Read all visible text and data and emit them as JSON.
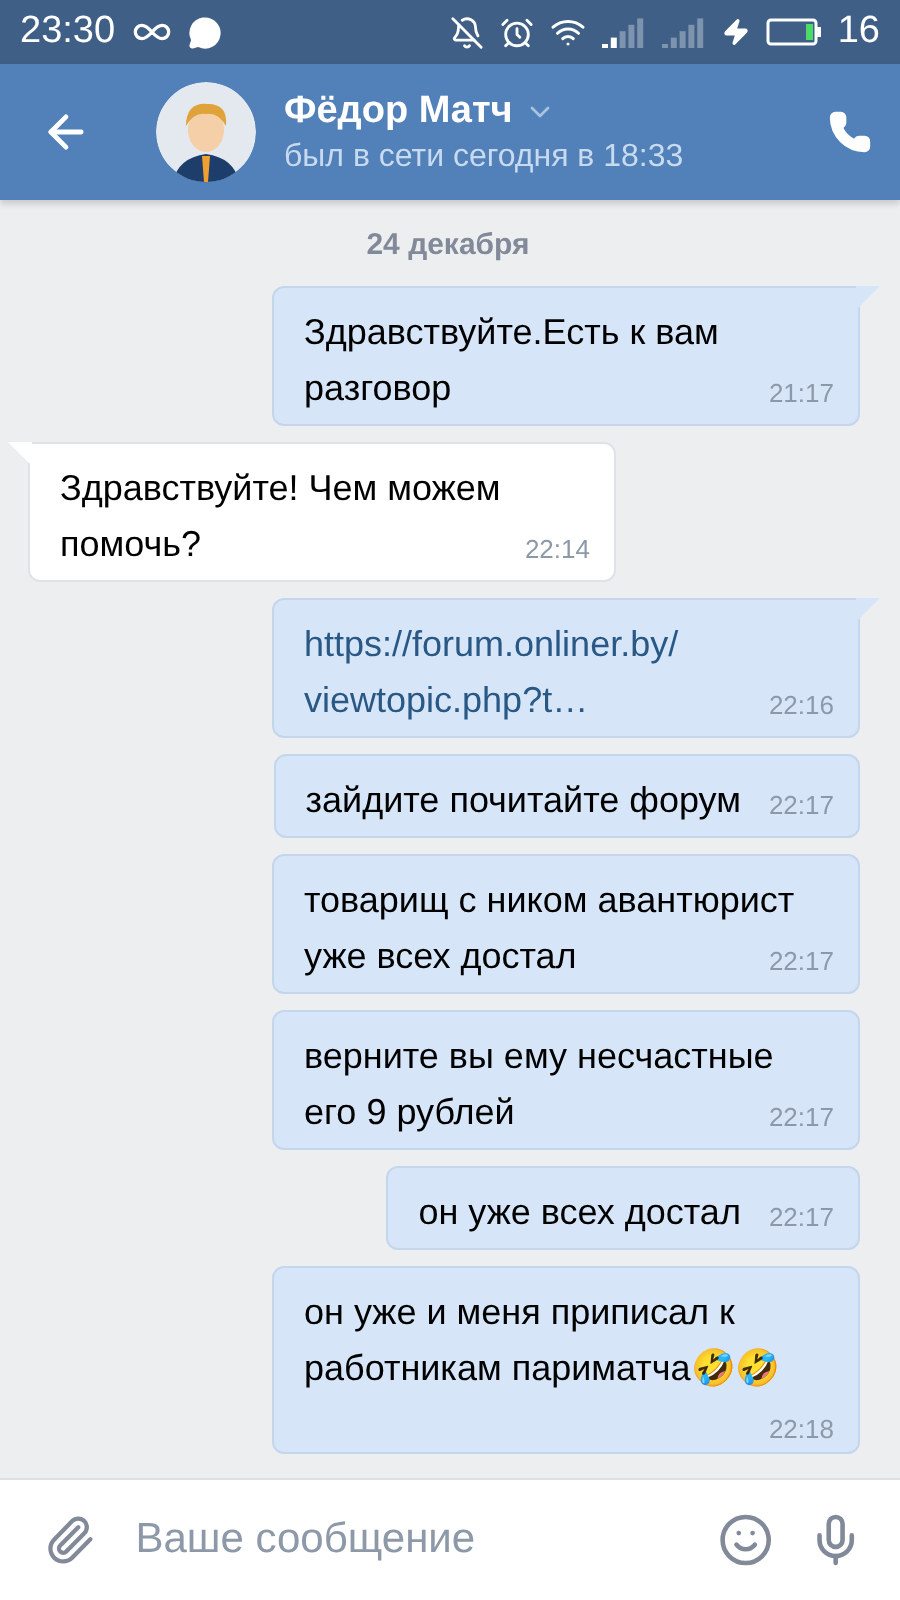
{
  "status_bar": {
    "time": "23:30",
    "battery_percent": "16"
  },
  "header": {
    "name": "Фёдор Матч",
    "status": "был в сети сегодня в 18:33"
  },
  "date_label": "24 декабря",
  "messages": [
    {
      "kind": "out",
      "text": "Здравствуйте.Есть к вам разговор",
      "time": "21:17",
      "tail": true
    },
    {
      "kind": "in",
      "text": "Здравствуйте! Чем можем помочь?",
      "time": "22:14",
      "tail": true
    },
    {
      "kind": "link",
      "text": "https://forum.onliner.by/ viewtopic.php?t…",
      "time": "22:16",
      "tail": true
    },
    {
      "kind": "out",
      "text": "зайдите почитайте форум",
      "time": "22:17",
      "tail": false
    },
    {
      "kind": "out",
      "text": "товарищ с ником авантюрист уже всех достал",
      "time": "22:17",
      "tail": false
    },
    {
      "kind": "out",
      "text": "верните вы ему несчастные его 9 рублей",
      "time": "22:17",
      "tail": false
    },
    {
      "kind": "out",
      "text": "он уже всех достал",
      "time": "22:17",
      "tail": false
    },
    {
      "kind": "out",
      "text": "он уже и меня приписал к работникам париматча🤣🤣",
      "time": "22:18",
      "tail": false
    }
  ],
  "composer": {
    "placeholder": "Ваше сообщение"
  }
}
